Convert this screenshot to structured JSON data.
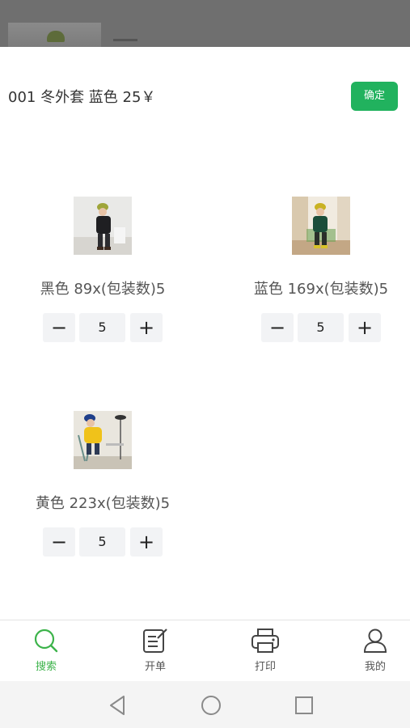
{
  "sheet": {
    "title": "001 冬外套 蓝色 25￥",
    "confirm_label": "确定"
  },
  "variants": [
    {
      "label": "黑色 89x(包装数)5",
      "quantity": "5",
      "minus": "−",
      "plus": "+"
    },
    {
      "label": "蓝色 169x(包装数)5",
      "quantity": "5",
      "minus": "−",
      "plus": "+"
    },
    {
      "label": "黄色 223x(包装数)5",
      "quantity": "5",
      "minus": "−",
      "plus": "+"
    }
  ],
  "tabbar": {
    "items": [
      {
        "label": "搜索",
        "icon": "search-icon",
        "active": true
      },
      {
        "label": "开单",
        "icon": "edit-icon",
        "active": false
      },
      {
        "label": "打印",
        "icon": "printer-icon",
        "active": false
      },
      {
        "label": "我的",
        "icon": "user-icon",
        "active": false
      }
    ]
  },
  "colors": {
    "accent": "#21b25e",
    "tab_active": "#3cb34a",
    "text": "#333333"
  }
}
